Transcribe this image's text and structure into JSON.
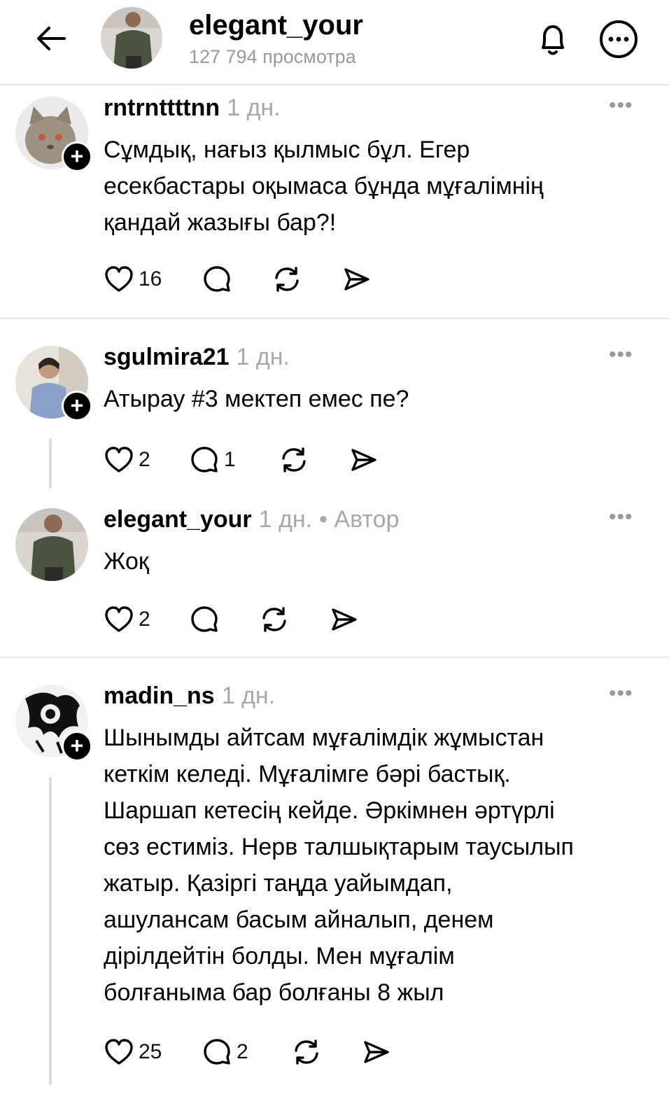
{
  "header": {
    "title": "elegant_your",
    "subtitle": "127 794 просмотра"
  },
  "comments": [
    {
      "user": "rntrnttttnn",
      "time": "1 дн.",
      "author_tag": "",
      "lines": [
        "Сұмдық, нағыз қылмыс бұл. Егер",
        "есекбастары оқымаса бұнда мұғалімнің",
        "қандай жазығы бар?!"
      ],
      "likes": "16",
      "replies": ""
    },
    {
      "user": "sgulmira21",
      "time": "1 дн.",
      "author_tag": "",
      "lines": [
        "Атырау #3 мектеп емес пе?"
      ],
      "likes": "2",
      "replies": "1"
    },
    {
      "user": "elegant_your",
      "time": "1 дн.",
      "author_tag": "• Автор",
      "lines": [
        "Жоқ"
      ],
      "likes": "2",
      "replies": ""
    },
    {
      "user": "madin_ns",
      "time": "1 дн.",
      "author_tag": "",
      "lines": [
        "Шынымды айтсам мұғалімдік жұмыстан",
        "кеткім келеді. Мұғалімге бәрі бастық.",
        "Шаршап кетесің кейде. Әркімнен әртүрлі",
        "сөз естиміз. Нерв талшықтарым таусылып",
        "жатыр. Қазіргі таңда уайымдап,",
        "ашулансам басым айналып, денем",
        "дірілдейтін болды. Мен мұғалім",
        "болғаныма бар болғаны 8 жыл"
      ],
      "likes": "25",
      "replies": "2"
    }
  ]
}
